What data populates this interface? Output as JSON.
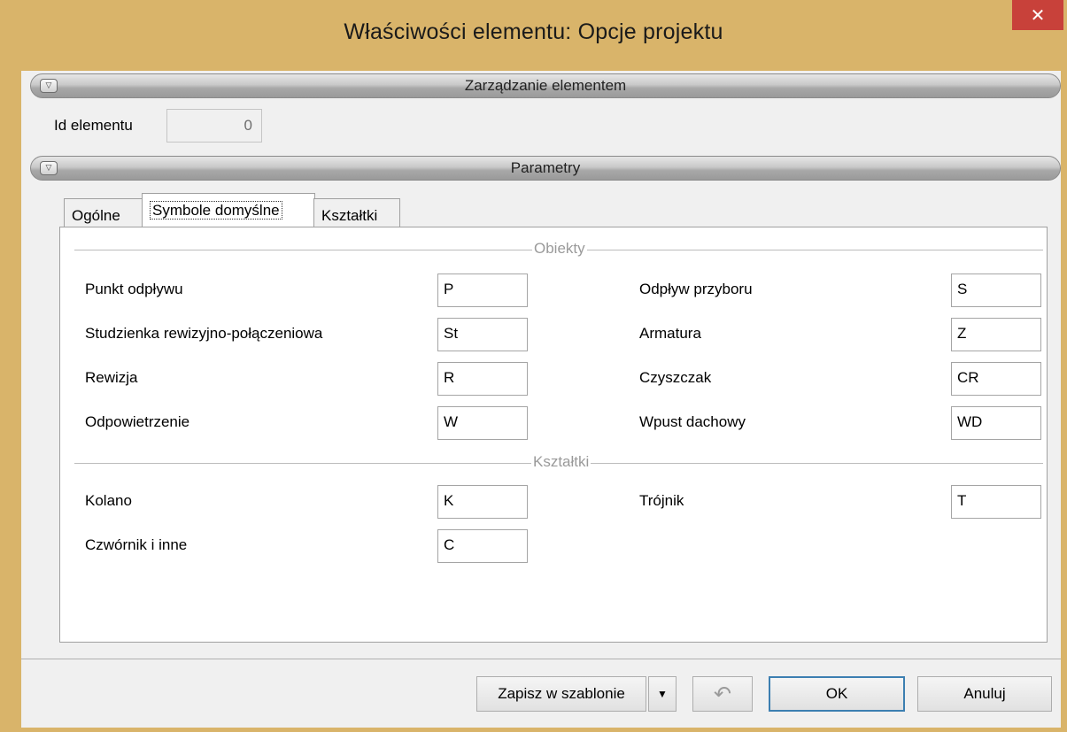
{
  "window": {
    "title": "Właściwości elementu: Opcje projektu",
    "close_glyph": "✕"
  },
  "management": {
    "section_label": "Zarządzanie elementem",
    "id_label": "Id elementu",
    "id_value": "0"
  },
  "parameters": {
    "section_label": "Parametry",
    "tabs": [
      "Ogólne",
      "Symbole domyślne",
      "Kształtki"
    ],
    "active_tab": "Symbole domyślne"
  },
  "objects_group": {
    "title": "Obiekty",
    "fields": [
      {
        "label": "Punkt odpływu",
        "value": "P"
      },
      {
        "label": "Odpływ przyboru",
        "value": "S"
      },
      {
        "label": "Studzienka rewizyjno-połączeniowa",
        "value": "St"
      },
      {
        "label": "Armatura",
        "value": "Z"
      },
      {
        "label": "Rewizja",
        "value": "R"
      },
      {
        "label": "Czyszczak",
        "value": "CR"
      },
      {
        "label": "Odpowietrzenie",
        "value": "W"
      },
      {
        "label": "Wpust dachowy",
        "value": "WD"
      }
    ]
  },
  "fittings_group": {
    "title": "Kształtki",
    "fields": [
      {
        "label": "Kolano",
        "value": "K"
      },
      {
        "label": "Trójnik",
        "value": "T"
      },
      {
        "label": "Czwórnik i inne",
        "value": "C"
      }
    ]
  },
  "footer": {
    "save_template_label": "Zapisz w szablonie",
    "dropdown_glyph": "▼",
    "undo_glyph": "↶",
    "ok_label": "OK",
    "cancel_label": "Anuluj"
  },
  "colors": {
    "title_bar": "#d9b46a",
    "close_button": "#c8413a",
    "primary_border": "#3c7fb1"
  }
}
